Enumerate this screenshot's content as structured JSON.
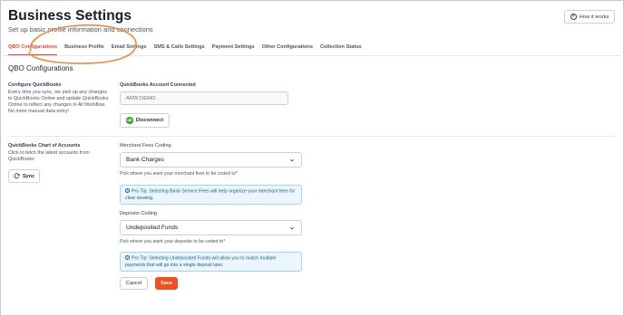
{
  "page": {
    "title": "Business Settings",
    "subtitle": "Set up basic profile information and connections",
    "how_it_works_label": "How it works",
    "section_title": "QBO Configurations"
  },
  "tabs": [
    {
      "label": "QBO Configurations",
      "active": true
    },
    {
      "label": "Business Profile",
      "active": false
    },
    {
      "label": "Email Settings",
      "active": false
    },
    {
      "label": "SMS & Calls Settings",
      "active": false
    },
    {
      "label": "Payment Settings",
      "active": false
    },
    {
      "label": "Other Configurations",
      "active": false
    },
    {
      "label": "Collection Status",
      "active": false
    }
  ],
  "configure": {
    "title": "Configure QuickBooks",
    "description": "Every time you sync, we pick up any changes to QuickBooks Online and update QuickBooks Online to reflect any changes in All Workflow. No more manual data entry!",
    "account_label": "QuickBooks Account Connected",
    "account_value": "ARW DEMO",
    "disconnect_label": "Disconnect",
    "qb_logo_text": "qb"
  },
  "chart_of_accounts": {
    "title": "QuickBooks Chart of Accounts",
    "description": "Click to fetch the latest accounts from QuickBooks",
    "sync_label": "Sync"
  },
  "merchant_fees": {
    "label": "Merchant Fees Coding",
    "value": "Bank Charges",
    "helper": "Pick where you want your merchant fees to be coded to*",
    "tip": "Pro Tip: Selecting Bank Service Fees will help organize your merchant fees for clear viewing."
  },
  "deposits": {
    "label": "Deposits Coding",
    "value": "Undeposited Funds",
    "helper": "Pick where you want your deposits to be coded to*",
    "tip": "Pro Tip: Selecting Undeposited Funds will allow you to match multiple payments that will go into a single deposit later."
  },
  "actions": {
    "cancel_label": "Cancel",
    "save_label": "Save"
  },
  "colors": {
    "accent": "#e2492b",
    "save": "#f04e23",
    "annotation": "#f08a3c",
    "tip_bg": "#eaf5fc",
    "qb_green": "#2ca01c"
  }
}
